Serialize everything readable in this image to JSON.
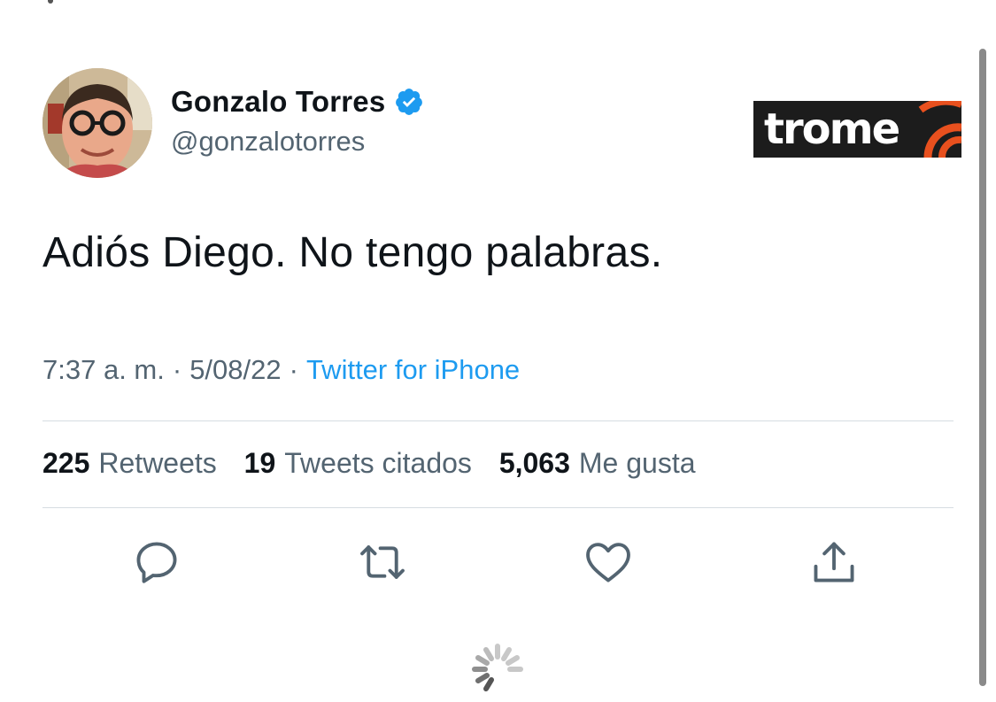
{
  "author": {
    "display_name": "Gonzalo Torres",
    "handle": "@gonzalotorres",
    "verified": true
  },
  "brand": {
    "logo_text": "trome",
    "logo_color": "#e8501e"
  },
  "tweet": {
    "text": "Adiós Diego. No tengo palabras."
  },
  "meta": {
    "time": "7:37 a. m.",
    "separator": "·",
    "date": "5/08/22",
    "source": "Twitter for iPhone"
  },
  "stats": {
    "retweets_count": "225",
    "retweets_label": "Retweets",
    "quotes_count": "19",
    "quotes_label": "Tweets citados",
    "likes_count": "5,063",
    "likes_label": "Me gusta"
  },
  "actions": [
    {
      "name": "reply",
      "icon": "reply-icon"
    },
    {
      "name": "retweet",
      "icon": "retweet-icon"
    },
    {
      "name": "like",
      "icon": "heart-icon"
    },
    {
      "name": "share",
      "icon": "share-icon"
    }
  ],
  "colors": {
    "text_primary": "#0f1419",
    "text_secondary": "#536471",
    "accent": "#1d9bf0",
    "divider": "#d6dde2"
  }
}
